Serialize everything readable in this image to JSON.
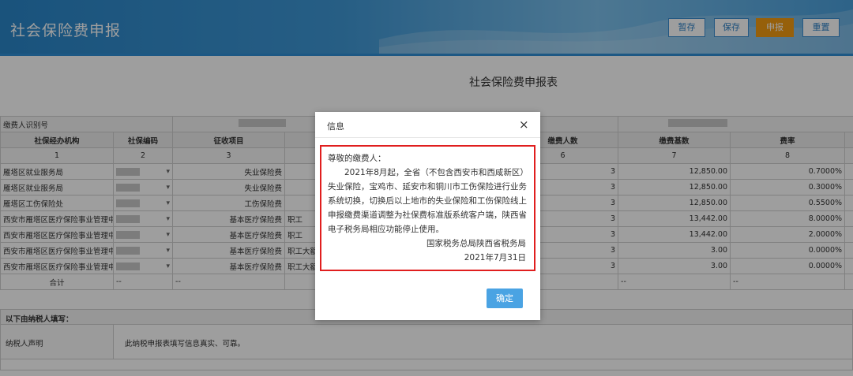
{
  "header": {
    "title": "社会保险费申报",
    "buttons": {
      "draft": "暂存",
      "save": "保存",
      "submit": "申报",
      "reset": "重置"
    }
  },
  "form": {
    "title": "社会保险费申报表",
    "payer_id_label": "缴费人识别号",
    "payer_name_label": "称",
    "columns": [
      "社保经办机构",
      "社保编码",
      "征收项目",
      "",
      "缴费人数",
      "缴费基数",
      "费率"
    ],
    "column_numbers": [
      "1",
      "2",
      "3",
      "",
      "6",
      "7",
      "8"
    ],
    "rows": [
      {
        "agency": "雁塔区就业服务局",
        "item": "失业保险费",
        "sub": "",
        "count": "3",
        "base": "12,850.00",
        "rate": "0.7000%"
      },
      {
        "agency": "雁塔区就业服务局",
        "item": "失业保险费",
        "sub": "",
        "count": "3",
        "base": "12,850.00",
        "rate": "0.3000%"
      },
      {
        "agency": "雁塔区工伤保险处",
        "item": "工伤保险费",
        "sub": "",
        "count": "3",
        "base": "12,850.00",
        "rate": "0.5500%"
      },
      {
        "agency": "西安市雁塔区医疗保险事业管理中",
        "item": "基本医疗保险费",
        "sub": "职工",
        "count": "3",
        "base": "13,442.00",
        "rate": "8.0000%"
      },
      {
        "agency": "西安市雁塔区医疗保险事业管理中",
        "item": "基本医疗保险费",
        "sub": "职工",
        "count": "3",
        "base": "13,442.00",
        "rate": "2.0000%"
      },
      {
        "agency": "西安市雁塔区医疗保险事业管理中",
        "item": "基本医疗保险费",
        "sub": "职工大额",
        "count": "3",
        "base": "3.00",
        "rate": "0.0000%"
      },
      {
        "agency": "西安市雁塔区医疗保险事业管理中",
        "item": "基本医疗保险费",
        "sub": "职工大额",
        "count": "3",
        "base": "3.00",
        "rate": "0.0000%"
      }
    ],
    "total": {
      "label": "合计",
      "dash": "--"
    },
    "declaration": {
      "heading": "以下由纳税人填写：",
      "label": "纳税人声明",
      "text": "此纳税申报表填写信息真实、可靠。"
    }
  },
  "dialog": {
    "title": "信息",
    "close": "×",
    "greeting": "尊敬的缴费人：",
    "body": "2021年8月起，全省（不包含西安市和西咸新区）失业保险，宝鸡市、延安市和铜川市工伤保险进行业务系统切换，切换后以上地市的失业保险和工伤保险线上申报缴费渠道调整为社保费标准版系统客户端，陕西省电子税务局相应功能停止使用。",
    "signature": "国家税务总局陕西省税务局",
    "date": "2021年7月31日",
    "ok_label": "确定"
  },
  "colors": {
    "header": "#2a86c9",
    "accent": "#f39c12",
    "ok_button": "#4aa3e3",
    "highlight_border": "#e01e1e"
  }
}
